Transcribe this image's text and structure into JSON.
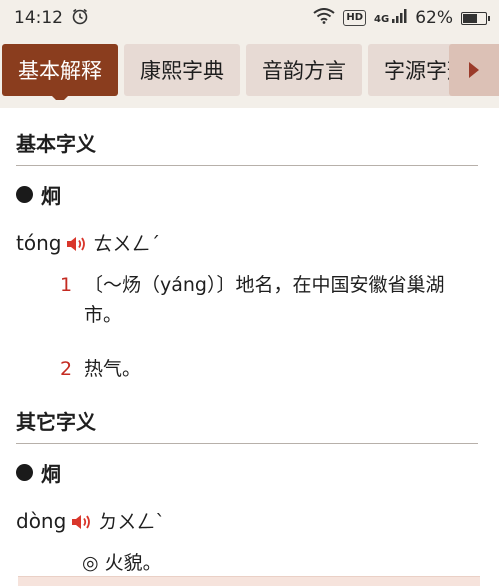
{
  "status": {
    "time": "14:12",
    "hd": "HD",
    "signal_label": "4G",
    "battery_text": "62%",
    "battery_level": 0.62
  },
  "tabs": [
    {
      "label": "基本解释",
      "active": true
    },
    {
      "label": "康熙字典",
      "active": false
    },
    {
      "label": "音韵方言",
      "active": false
    },
    {
      "label": "字源字形",
      "active": false
    }
  ],
  "basic": {
    "title": "基本字义",
    "char": "炯",
    "pinyin": "tóng",
    "zhuyin": "ㄊㄨㄥˊ",
    "definitions": [
      {
        "num": "1",
        "text": "〔～炀（yáng）〕地名，在中国安徽省巢湖市。"
      },
      {
        "num": "2",
        "text": "热气。"
      }
    ]
  },
  "other": {
    "title": "其它字义",
    "char": "烔",
    "pinyin": "dòng",
    "zhuyin": "ㄉㄨㄥˋ",
    "note": "◎ 火貌。"
  },
  "colors": {
    "accent": "#8a3d1e",
    "tab_bg": "#e7dad4",
    "number_red": "#c42b22",
    "speaker_red": "#d9362b"
  }
}
